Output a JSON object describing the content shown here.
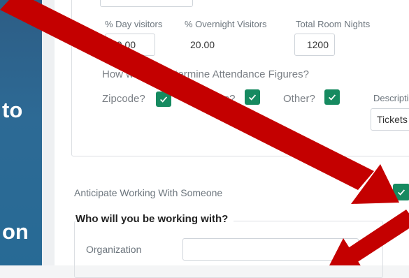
{
  "sidebar": {
    "fragment_1": "to",
    "fragment_2": "on"
  },
  "visitors": {
    "day_label": "% Day visitors",
    "day_value": "80.00",
    "overnight_label": "% Overnight Visitors",
    "overnight_value": "20.00",
    "room_nights_label": "Total Room Nights",
    "room_nights_value": "1200"
  },
  "attendance": {
    "question": "How will you determine Attendance Figures?",
    "zipcode_label": "Zipcode?",
    "surveys_label": "Surveys?",
    "other_label": "Other?",
    "description_label": "Description",
    "description_value": "Tickets"
  },
  "partner": {
    "anticipate_label": "Anticipate Working With Someone",
    "legend": "Who will you be working with?",
    "organization_label": "Organization",
    "organization_value": ""
  },
  "colors": {
    "sidebar": "#2d6a95",
    "checkbox": "#168a60",
    "arrow": "#c40000"
  }
}
